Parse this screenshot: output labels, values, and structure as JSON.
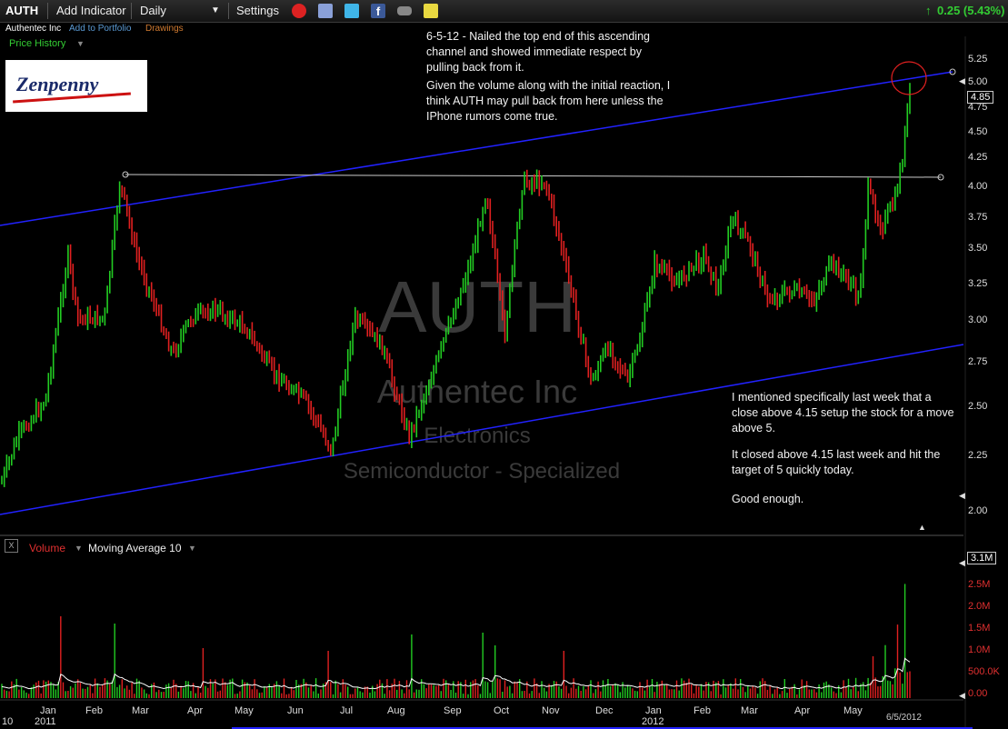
{
  "toolbar": {
    "symbol": "AUTH",
    "add_indicator": "Add Indicator",
    "interval": "Daily",
    "settings": "Settings",
    "change": "0.25 (5.43%)"
  },
  "subbar": {
    "company": "Authentec Inc",
    "add_portfolio": "Add to Portfolio",
    "drawings": "Drawings"
  },
  "panel": {
    "price_history": "Price History"
  },
  "logo": {
    "text": "Zenpenny"
  },
  "annotations": {
    "top_1": "6-5-12 - Nailed the top end of this ascending channel and showed immediate respect by pulling back from it.",
    "top_2": "Given the volume along with the initial reaction, I think AUTH may pull back from here unless the IPhone rumors come true.",
    "right_1": "I mentioned specifically last week that a close above 4.15 setup the stock for a move above 5.",
    "right_2": "It closed above 4.15 last week and hit the target of 5 quickly today.",
    "right_3": "Good enough."
  },
  "watermark": {
    "ticker": "AUTH",
    "name": "Authentec Inc",
    "sector": "Electronics",
    "industry": "Semiconductor - Specialized"
  },
  "price_axis": [
    "5.25",
    "5.00",
    "4.75",
    "4.50",
    "4.25",
    "4.00",
    "3.75",
    "3.50",
    "3.25",
    "3.00",
    "2.75",
    "2.50",
    "2.25",
    "2.00"
  ],
  "last_price": "4.85",
  "volume_panel": {
    "close_label": "X",
    "volume": "Volume",
    "ma": "Moving Average 10",
    "axis": [
      "2.5M",
      "2.0M",
      "1.5M",
      "1.0M",
      "500.0K",
      "0.00"
    ],
    "last": "3.1M"
  },
  "months": [
    "Jan",
    "Feb",
    "Mar",
    "Apr",
    "May",
    "Jun",
    "Jul",
    "Aug",
    "Sep",
    "Oct",
    "Nov",
    "Dec",
    "Jan",
    "Feb",
    "Mar",
    "Apr",
    "May"
  ],
  "years": {
    "y2011": "2011",
    "y2012": "2012",
    "left_clip": "10"
  },
  "date_label": "6/5/2012",
  "colors": {
    "up": "#22cc22",
    "down": "#e02020",
    "channel": "#2222ff",
    "resistance": "#cccccc",
    "accent": "#33cc33"
  }
}
